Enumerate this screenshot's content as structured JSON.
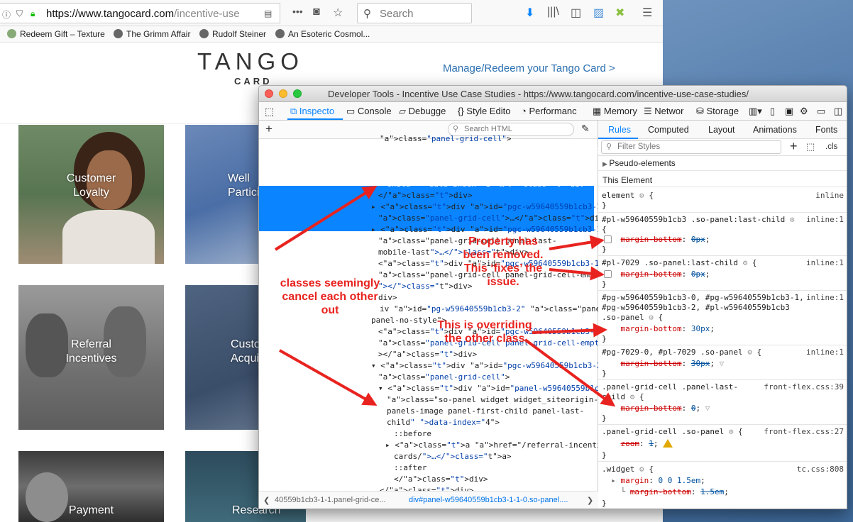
{
  "browser": {
    "url_host": "https://www.tangocard.com",
    "url_rest": "/incentive-use",
    "search_placeholder": "Search",
    "bookmarks": [
      "Redeem Gift – Texture",
      "The Grimm Affair",
      "Rudolf Steiner",
      "An Esoteric Cosmol..."
    ]
  },
  "site": {
    "logo_main": "TANGO",
    "logo_sub": "CARD",
    "manage_link": "Manage/Redeem your Tango Card >",
    "tiles": [
      {
        "label": "Customer\nLoyalty"
      },
      {
        "label": "Well\nPartici"
      },
      {
        "label": "Referral\nIncentives"
      },
      {
        "label": "Custo\nAcqui"
      },
      {
        "label": "Payment"
      },
      {
        "label": "Research"
      }
    ]
  },
  "devtools": {
    "title": "Developer Tools - Incentive Use Case Studies - https://www.tangocard.com/incentive-use-case-studies/",
    "tabs": [
      "Inspecto",
      "Console",
      "Debugge",
      "Style Edito",
      "Performanc",
      "Memory",
      "Networ",
      "Storage"
    ],
    "search_html_placeholder": "Search HTML",
    "markup_lines": [
      {
        "html": "class=\"panel-grid-cell\">"
      },
      {
        "html": "▸ <div id=\"panel-w59640559b1cb3-1-1-0\""
      },
      {
        "html": "class=\"so-panel widget widget_siteorigin-"
      },
      {
        "html": "panels-image panel-first-child panel-last-"
      },
      {
        "html": "child\" data-index=\"1\">…</div>"
      },
      {
        "html": "</div>"
      },
      {
        "html": "▸ <div id=\"pgc-w59640559b1cb3-1-2\""
      },
      {
        "html": "class=\"panel-grid-cell\">…</div>"
      },
      {
        "html": "▸ <div id=\"pgc-w59640559b1cb3-1-3\""
      },
      {
        "html": "class=\"panel-grid-cell panel-last-"
      },
      {
        "html": "mobile-last\">…</div>"
      },
      {
        "html": "<div id=\"pgc-w59640559b1cb3-1-4\""
      },
      {
        "html": "class=\"panel-grid-cell panel-grid-cell-empty"
      },
      {
        "html": "\"></div>"
      },
      {
        "html": "div>"
      },
      {
        "html": "iv id=\"pg-w59640559b1cb3-2\" class=\"panel-grid"
      },
      {
        "html": "panel-no-style\">"
      },
      {
        "html": "<div id=\"pgc-w59640559b1cb3-2-0\""
      },
      {
        "html": "class=\"panel-grid-cell panel-grid-cell-empty\""
      },
      {
        "html": "></div>"
      },
      {
        "html": "▾ <div id=\"pgc-w59640559b1cb3-2-1\""
      },
      {
        "html": "class=\"panel-grid-cell\">"
      },
      {
        "html": "▾ <div id=\"panel-w59640559b1cb3-2-1-0\""
      },
      {
        "html": "class=\"so-panel widget widget_siteorigin-"
      },
      {
        "html": "panels-image panel-first-child panel-last-"
      },
      {
        "html": "child\" data-index=\"4\">"
      },
      {
        "html": "::before"
      },
      {
        "html": "▸ <a href=\"/referral-incentives-e-gift-"
      },
      {
        "html": "cards/\">…</a>"
      },
      {
        "html": "::after"
      },
      {
        "html": "</div>"
      },
      {
        "html": "</div>"
      }
    ],
    "breadcrumbs": [
      "40559b1cb3-1-1.panel-grid-ce...",
      "div#panel-w59640559b1cb3-1-1-0.so-panel...."
    ],
    "rules_tabs": [
      "Rules",
      "Computed",
      "Layout",
      "Animations",
      "Fonts"
    ],
    "filter_placeholder": "Filter Styles",
    "cls_label": ".cls",
    "pseudo_elements": "Pseudo-elements",
    "this_element": "This Element",
    "rules": [
      {
        "selector": "element",
        "source": "inline",
        "lines": [
          "}"
        ]
      },
      {
        "selector": "#pl-w59640559b1cb3 .so-panel:last-child",
        "source": "inline:1",
        "prop": "margin-bottom",
        "value": "0px"
      },
      {
        "selector": "#pl-7029 .so-panel:last-child",
        "source": "inline:1",
        "prop": "margin-bottom",
        "value": "0px"
      },
      {
        "selector": "#pg-w59640559b1cb3-0, #pg-w59640559b1cb3-1,",
        "selector2": "#pg-w59640559b1cb3-2, #pl-w59640559b1cb3",
        "selector3": ".so-panel",
        "source": "inline:1",
        "prop": "margin-bottom",
        "value": "30px"
      },
      {
        "selector": "#pg-7029-0, #pl-7029 .so-panel",
        "source": "inline:1",
        "prop": "margin-bottom",
        "value": "30px"
      },
      {
        "selector": ".panel-grid-cell .panel-last-",
        "selector2": "child",
        "source": "front-flex.css:39",
        "prop": "margin-bottom",
        "value": "0"
      },
      {
        "selector": ".panel-grid-cell .so-panel",
        "source": "front-flex.css:27",
        "prop": "zoom",
        "value": "1"
      },
      {
        "selector": ".widget",
        "source": "tc.css:808",
        "prop": "margin",
        "value": "0 0 1.5em",
        "subprop": "margin-bottom",
        "subvalue": "1.5em"
      }
    ]
  },
  "annotations": {
    "removed": "Property has\nbeen removed.\nThis ‘fixes’ the\nissue.",
    "cancel": "classes seemingly\ncancel each other\nout",
    "overriding": "This is overriding\nthe other class"
  },
  "colors": {
    "accent": "#0a84ff",
    "annotation": "#e8231f",
    "link": "#2a6fb0"
  }
}
